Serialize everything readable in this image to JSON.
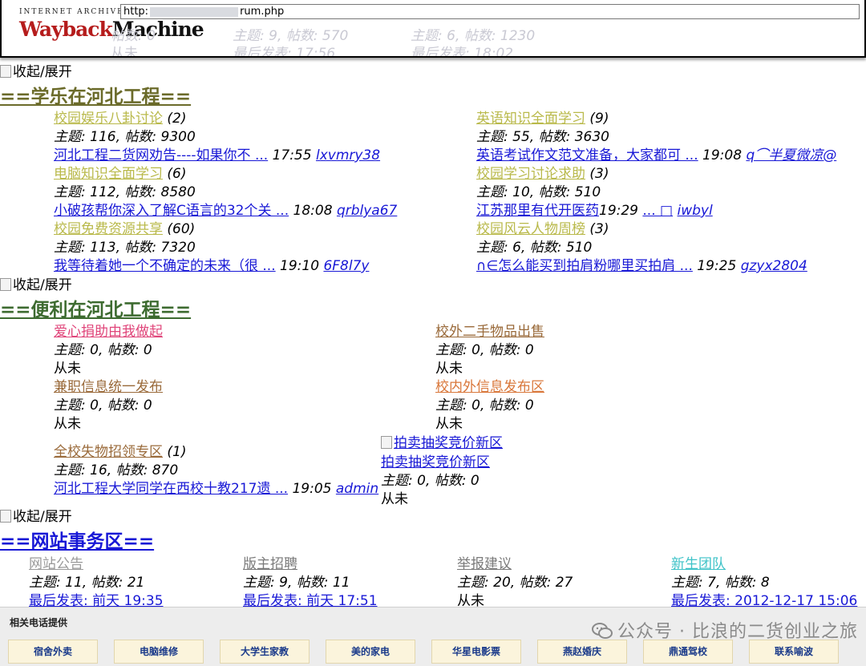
{
  "wayback": {
    "logo_top": "INTERNET ARCHIVE",
    "logo_part1": "Wayback",
    "logo_part2": "Machine",
    "url_prefix": "http:",
    "url_suffix": "rum.php",
    "ghost": {
      "a": "帖数: 0",
      "b": "主题: 9, 帖数: 570",
      "c": "主题: 6, 帖数: 1230",
      "d": "从未",
      "e": "最后发表: 17:56",
      "f": "最后发表: 18:02"
    }
  },
  "toggle_label": "收起/展开",
  "sections": {
    "s1": {
      "title": "==学乐在河北工程==",
      "title_color": "#6b6b2a",
      "forum_color": "#b9b94a",
      "forums": [
        {
          "name": "校园娱乐八卦讨论",
          "count": "(2)",
          "stats": "主题: 116, 帖数: 9300",
          "last": "河北工程二货网劝告----如果你不 ...",
          "time": "17:55",
          "user": "lxvmry38"
        },
        {
          "name": "英语知识全面学习",
          "count": "(9)",
          "stats": "主题: 55, 帖数: 3630",
          "last": "英语考试作文范文准备，大家都可 ...",
          "time": "19:08",
          "user": "q⌒半夏微凉@"
        },
        {
          "name": "电脑知识全面学习",
          "count": "(6)",
          "stats": "主题: 112, 帖数: 8580",
          "last": "小破孩帮你深入了解C语言的32个关 ...",
          "time": "18:08",
          "user": "qrblya67"
        },
        {
          "name": "校园学习讨论求助",
          "count": "(3)",
          "stats": "主题: 10, 帖数: 510",
          "last": "江苏那里有代开医药",
          "time": "19:29",
          "user": "iwbyl",
          "last_extra": "... □"
        },
        {
          "name": "校园免费资源共享",
          "count": "(60)",
          "stats": "主题: 113, 帖数: 7320",
          "last": "我等待着她一个不确定的未来（很 ...",
          "time": "19:10",
          "user": "6F8l7y"
        },
        {
          "name": "校园风云人物周榜",
          "count": "(3)",
          "stats": "主题: 6, 帖数: 510",
          "last": "∩∈怎么能买到拍肩粉哪里买拍肩 ...",
          "time": "19:25",
          "user": "gzyx2804"
        }
      ]
    },
    "s2": {
      "title": "==便利在河北工程==",
      "title_color": "#3d6b30",
      "forums": [
        {
          "name": "爱心捐助由我做起",
          "color": "#e0457a",
          "stats": "主题: 0, 帖数: 0",
          "last": "从未"
        },
        {
          "name": "校外二手物品出售",
          "color": "#9a6a3a",
          "stats": "主题: 0, 帖数: 0",
          "last": "从未"
        },
        {
          "name": "兼职信息统一发布",
          "color": "#9a6a3a",
          "stats": "主题: 0, 帖数: 0",
          "last": "从未"
        },
        {
          "name": "校内外信息发布区",
          "color": "#d9773a",
          "stats": "主题: 0, 帖数: 0",
          "last": "从未"
        },
        {
          "name": "全校失物招领专区",
          "color": "#9a6a3a",
          "count": "(1)",
          "stats": "主题: 16, 帖数: 870",
          "last": "河北工程大学同学在西校十教217遗 ...",
          "time": "19:05",
          "user": "admin"
        },
        {
          "name": "拍卖抽奖竞价新区",
          "img_alt": "拍卖抽奖竞价新区",
          "color": "#1818d6",
          "stats": "主题: 0, 帖数: 0",
          "last": "从未"
        }
      ]
    },
    "s3": {
      "title": "==网站事务区==",
      "title_color": "#1818d6",
      "forums": [
        {
          "name": "网站公告",
          "color": "#9a9a9a",
          "stats": "主题: 11, 帖数: 21",
          "last": "最后发表: 前天 19:35"
        },
        {
          "name": "版主招聘",
          "color": "#7a7a7a",
          "stats": "主题: 9, 帖数: 11",
          "last": "最后发表: 前天 17:51"
        },
        {
          "name": "举报建议",
          "color": "#7a7a7a",
          "stats": "主题: 20, 帖数: 27",
          "last": "从未"
        },
        {
          "name": "新生团队",
          "color": "#3fc3c8",
          "stats": "主题: 7, 帖数: 8",
          "last": "最后发表: 2012-12-17 15:06"
        }
      ]
    }
  },
  "phone_panel": {
    "title": "相关电话提供",
    "buttons": [
      "宿舍外卖",
      "电脑维修",
      "大学生家教",
      "美的家电",
      "华星电影票",
      "燕赵婚庆",
      "鼎通驾校",
      "联系喻波"
    ]
  },
  "watermark": "公众号 · 比浪的二货创业之旅"
}
